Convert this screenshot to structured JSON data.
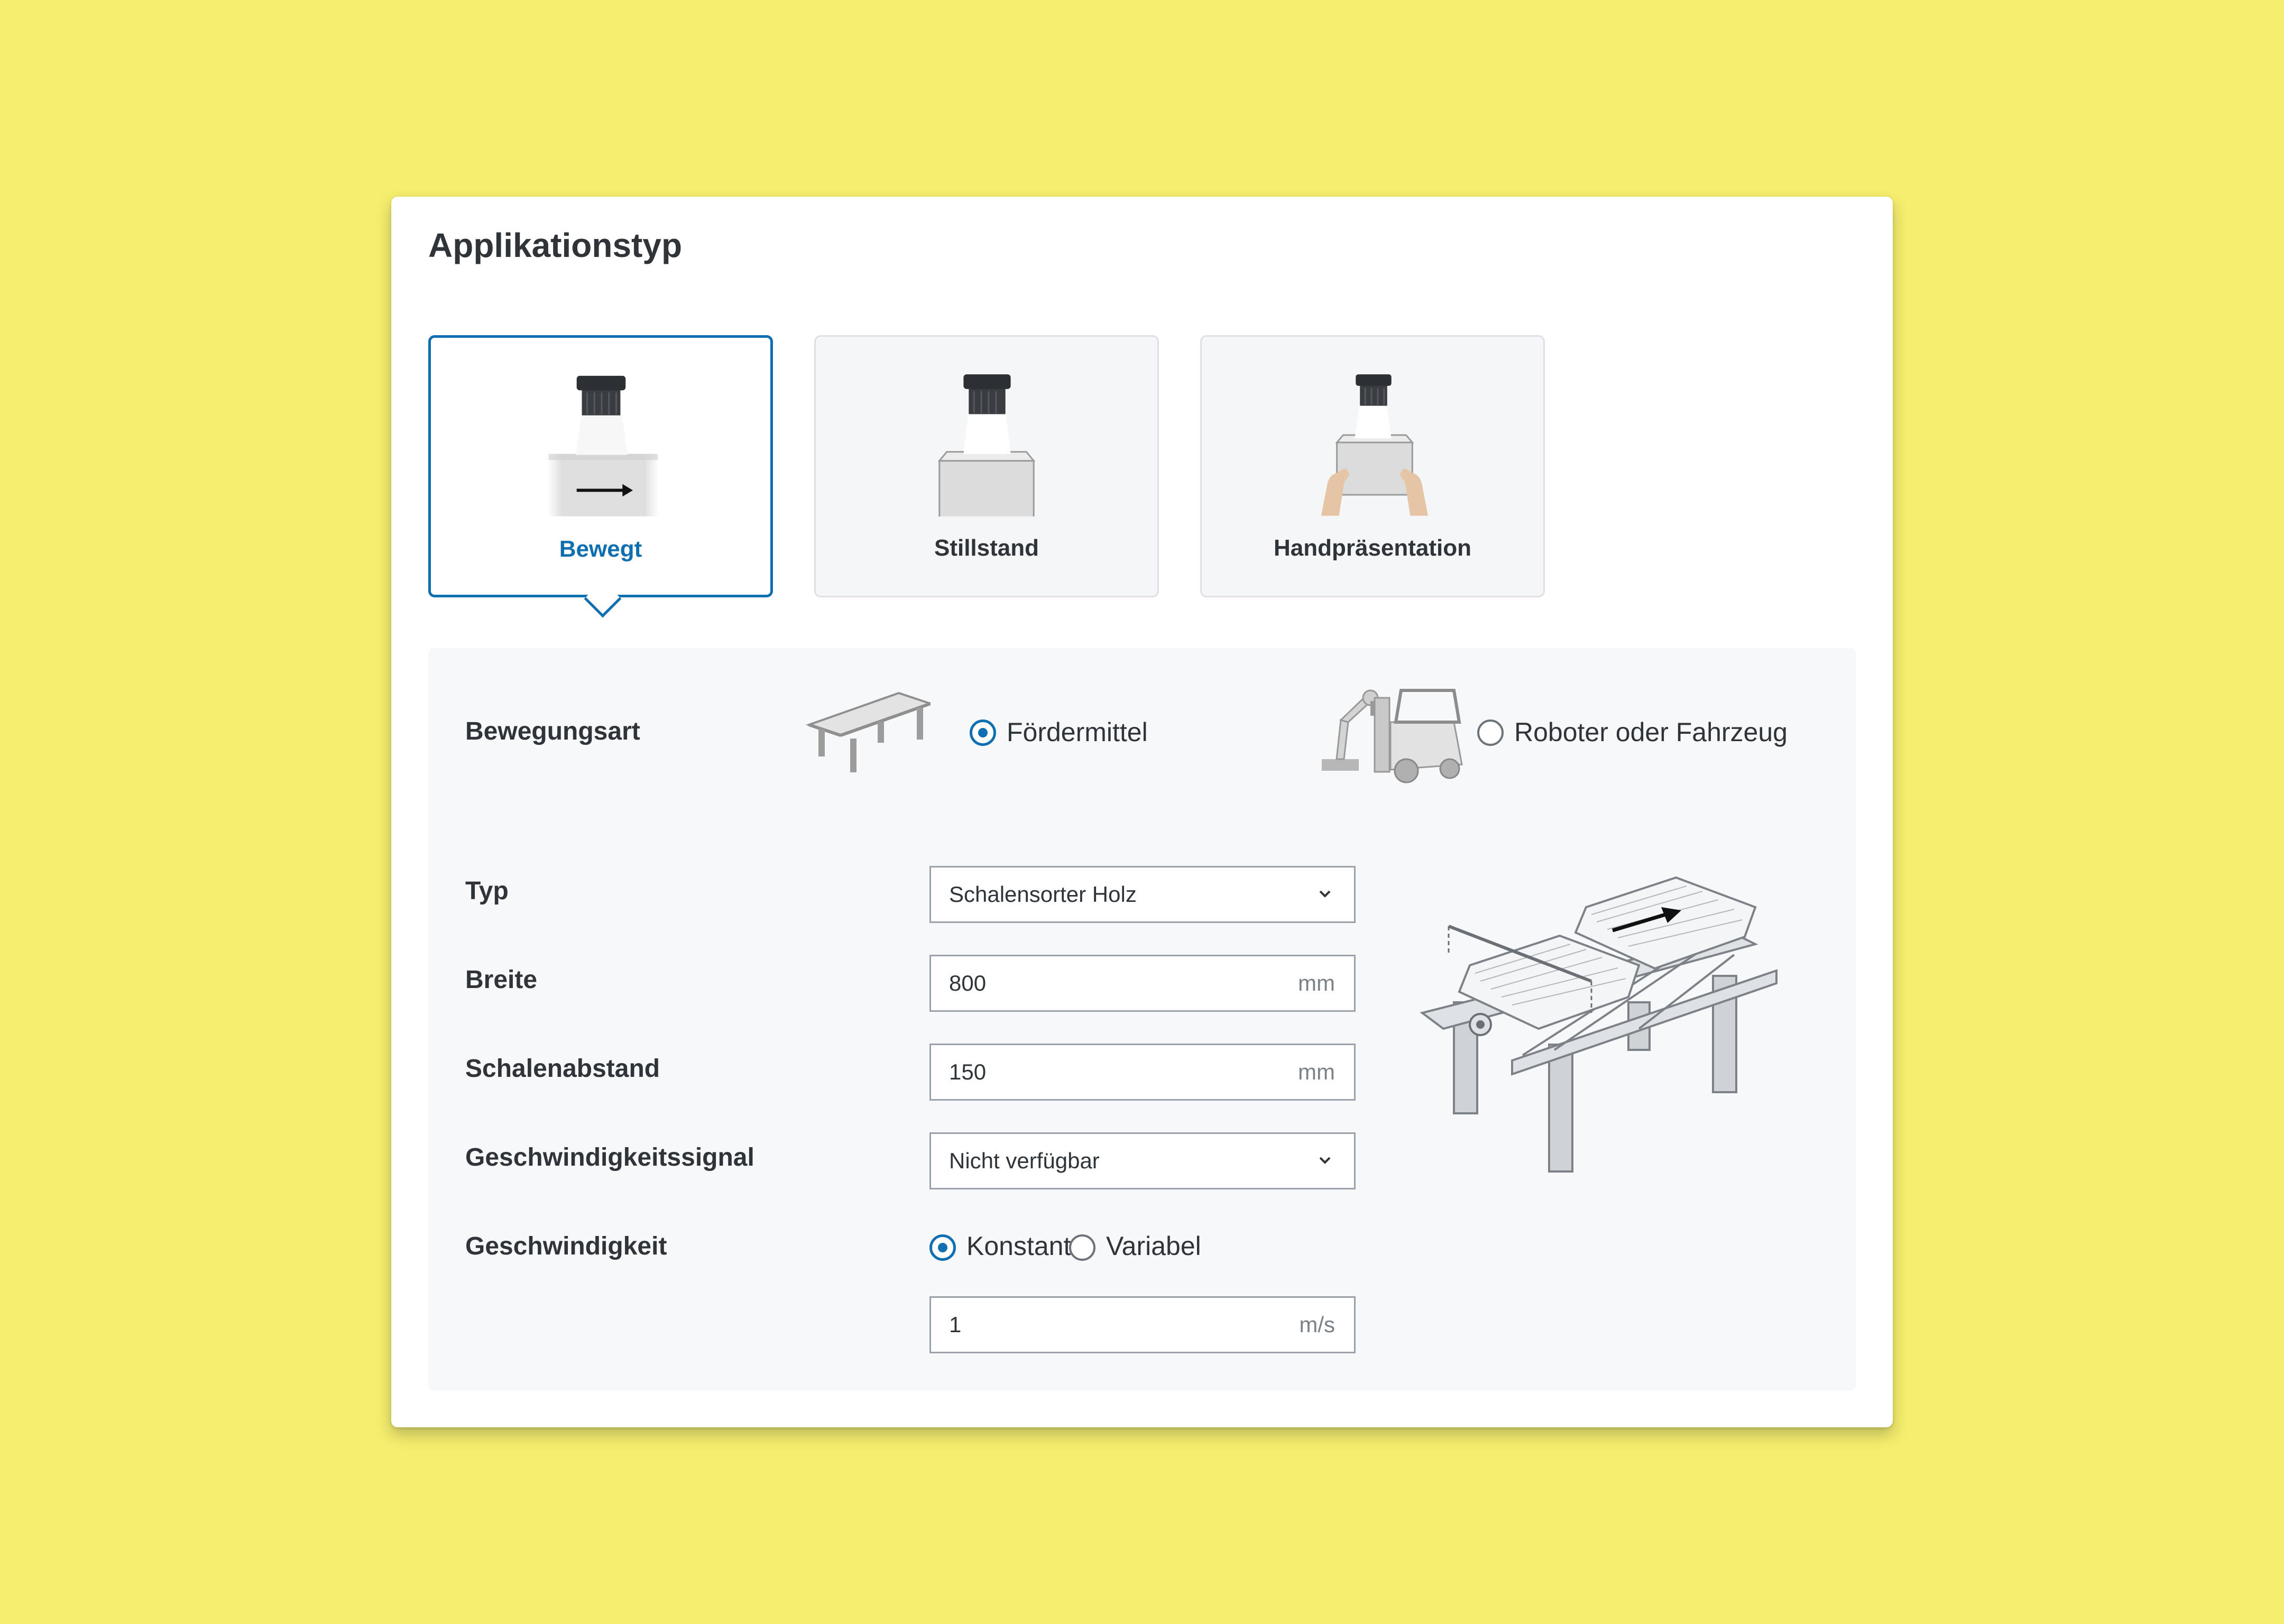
{
  "card": {
    "title": "Applikationstyp"
  },
  "tiles": [
    {
      "label": "Bewegt",
      "selected": true
    },
    {
      "label": "Stillstand",
      "selected": false
    },
    {
      "label": "Handpräsentation",
      "selected": false
    }
  ],
  "motion": {
    "label": "Bewegungsart",
    "options": [
      {
        "label": "Fördermittel",
        "selected": true
      },
      {
        "label": "Roboter oder Fahrzeug",
        "selected": false
      }
    ]
  },
  "form": {
    "type": {
      "label": "Typ",
      "value": "Schalensorter Holz"
    },
    "width": {
      "label": "Breite",
      "value": "800",
      "unit": "mm"
    },
    "spacing": {
      "label": "Schalenabstand",
      "value": "150",
      "unit": "mm"
    },
    "speed_signal": {
      "label": "Geschwindigkeitssignal",
      "value": "Nicht verfügbar"
    },
    "speed": {
      "label": "Geschwindigkeit",
      "options": [
        {
          "label": "Konstant",
          "selected": true
        },
        {
          "label": "Variabel",
          "selected": false
        }
      ],
      "value": "1",
      "unit": "m/s"
    }
  },
  "colors": {
    "background": "#f5ee6e",
    "accent": "#0f6fb0",
    "card": "#ffffff",
    "panel": "#f6f8fa",
    "text": "#2f3439"
  },
  "icons": [
    "camera-icon",
    "moving-box-icon",
    "still-box-icon",
    "hand-held-box-icon",
    "conveyor-icon",
    "robot-forklift-icon",
    "chevron-down-icon",
    "tray-sorter-illustration"
  ]
}
